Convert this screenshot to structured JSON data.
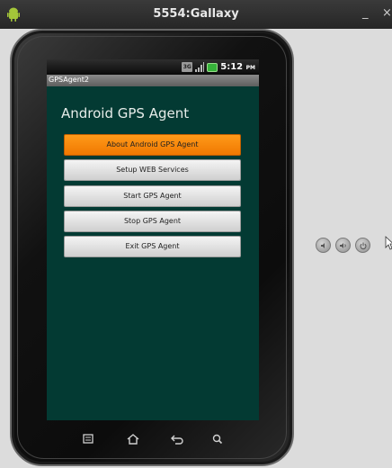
{
  "window": {
    "title": "5554:Gallaxy",
    "minimize_label": "_",
    "close_label": "×"
  },
  "status_bar": {
    "data_indicator": "3G",
    "time": "5:12",
    "ampm": "PM"
  },
  "app": {
    "title": "GPSAgent2",
    "heading": "Android GPS Agent",
    "menu": [
      {
        "label": "About Android GPS Agent",
        "active": true
      },
      {
        "label": "Setup WEB Services",
        "active": false
      },
      {
        "label": "Start GPS Agent",
        "active": false
      },
      {
        "label": "Stop GPS Agent",
        "active": false
      },
      {
        "label": "Exit GPS Agent",
        "active": false
      }
    ]
  },
  "soft_keys": [
    "menu-icon",
    "home-icon",
    "back-icon",
    "search-icon"
  ],
  "side_controls": [
    "volume-down-icon",
    "volume-up-icon",
    "power-icon"
  ],
  "colors": {
    "screen_bg": "#033a33",
    "active_button": "#f07800",
    "title_bar": "#2f2f2f",
    "battery": "#36b33a"
  }
}
